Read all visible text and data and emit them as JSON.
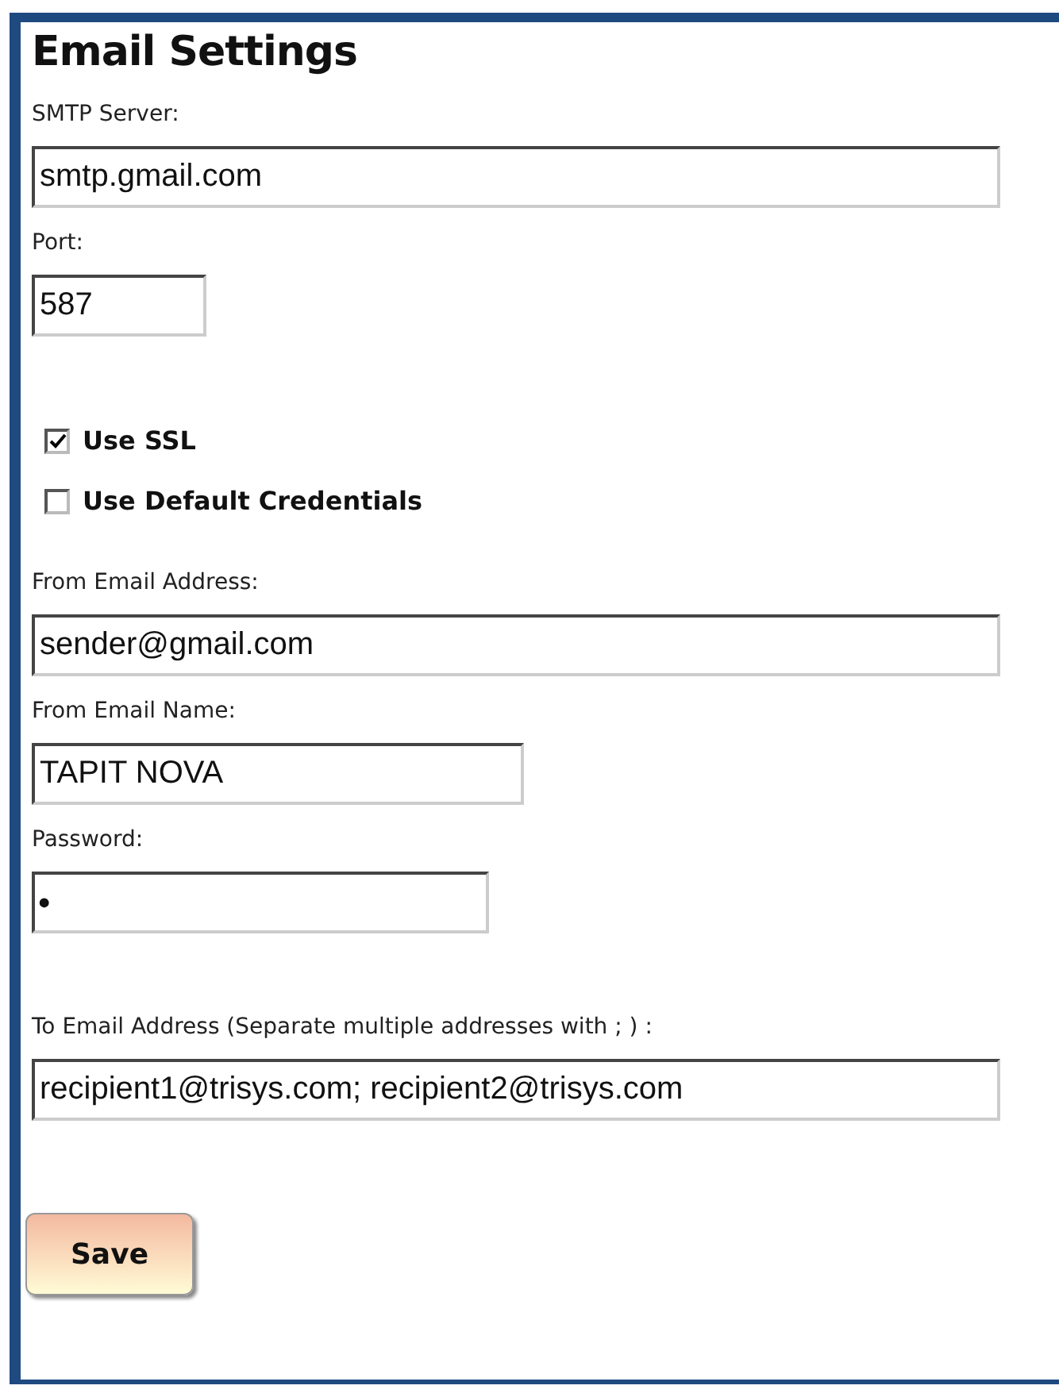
{
  "title": "Email Settings",
  "fields": [
    {
      "label": "SMTP Server:",
      "value": "smtp.gmail.com"
    },
    {
      "label": "Port:",
      "value": "587"
    }
  ],
  "options": [
    {
      "label": "Use SSL",
      "checked": true
    },
    {
      "label": "Use Default Credentials",
      "checked": false
    }
  ],
  "sender_fields": [
    {
      "label": "From Email Address:",
      "value": "sender@gmail.com"
    },
    {
      "label": "From Email Name:",
      "value": "TAPIT NOVA"
    },
    {
      "label": "Password:",
      "value": "•"
    }
  ],
  "recipient_field": {
    "label": "To Email Address (Separate multiple addresses with ; ) :",
    "value": "recipient1@trisys.com; recipient2@trisys.com"
  },
  "save_button": "Save"
}
